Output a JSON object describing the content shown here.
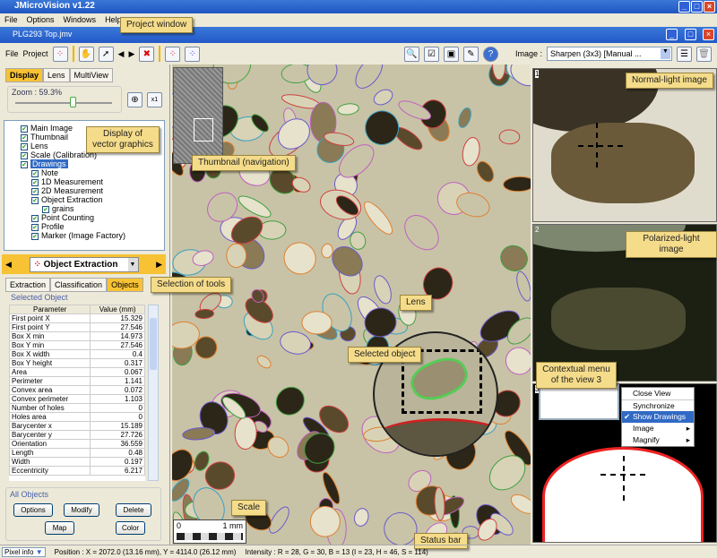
{
  "app": {
    "title": "JMicroVision v1.22",
    "menu": [
      "File",
      "Options",
      "Windows",
      "Help"
    ]
  },
  "project": {
    "title": "PLG293 Top.jmv",
    "toolbar_menu": [
      "File",
      "Project"
    ],
    "image_label": "Image :",
    "image_select": "Sharpen (3x3) [Manual ..."
  },
  "left": {
    "tabs": [
      "Display",
      "Lens",
      "MultiView"
    ],
    "zoom_label": "Zoom : 59.3%",
    "zoom_value": 59.3,
    "tree": [
      "Main Image",
      "Thumbnail",
      "Lens",
      "Scale (Calibration)",
      "Drawings",
      "Note",
      "1D Measurement",
      "2D Measurement",
      "Object Extraction",
      "grains",
      "Point Counting",
      "Profile",
      "Marker (Image Factory)"
    ],
    "tool": "Object Extraction",
    "subtabs": [
      "Extraction",
      "Classification",
      "Objects"
    ],
    "selected_object": "Selected Object",
    "columns": [
      "Parameter",
      "Value (mm)"
    ],
    "rows": [
      [
        "First point X",
        "15.329"
      ],
      [
        "First point Y",
        "27.546"
      ],
      [
        "Box X min",
        "14.973"
      ],
      [
        "Box Y min",
        "27.546"
      ],
      [
        "Box X width",
        "0.4"
      ],
      [
        "Box Y height",
        "0.317"
      ],
      [
        "Area",
        "0.067"
      ],
      [
        "Perimeter",
        "1.141"
      ],
      [
        "Convex area",
        "0.072"
      ],
      [
        "Convex perimeter",
        "1.103"
      ],
      [
        "Number of holes",
        "0"
      ],
      [
        "Holes area",
        "0"
      ],
      [
        "Barycenter x",
        "15.189"
      ],
      [
        "Barycenter y",
        "27.726"
      ],
      [
        "Orientation",
        "36.559"
      ],
      [
        "Length",
        "0.48"
      ],
      [
        "Width",
        "0.197"
      ],
      [
        "Eccentricity",
        "6.217"
      ]
    ],
    "all_objects": "All Objects",
    "buttons": [
      "Options",
      "Modify",
      "Delete",
      "Map",
      "Color"
    ]
  },
  "scale": {
    "start": "0",
    "end": "1 mm"
  },
  "views": [
    "1",
    "2",
    "3"
  ],
  "context_menu": {
    "items": [
      "Close View",
      "Synchronize",
      "Show Drawings",
      "Image",
      "Magnify"
    ],
    "checked": "Show Drawings"
  },
  "callouts": {
    "project_window": "Project window",
    "vector": "Display of vector graphics",
    "thumbnail": "Thumbnail (navigation)",
    "tools": "Selection of tools",
    "lens": "Lens",
    "selected": "Selected object",
    "scale": "Scale",
    "status": "Status bar",
    "normal": "Normal-light image",
    "polarized": "Polarized-light image",
    "context": "Contextual menu of the view 3"
  },
  "status": {
    "mode": "Pixel info",
    "position": "Position : X = 2072.0 (13.16 mm), Y = 4114.0 (26.12 mm)",
    "intensity": "Intensity : R = 28, G = 30, B = 13 (I = 23, H = 46, S = 114)"
  }
}
